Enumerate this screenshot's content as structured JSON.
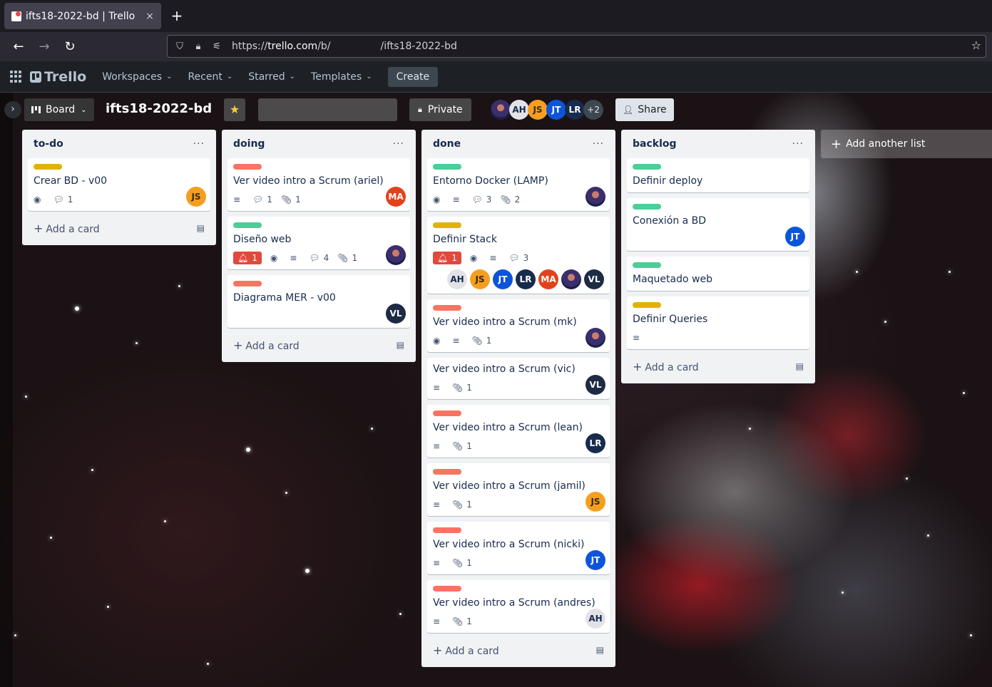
{
  "browser": {
    "tab_title": "ifts18-2022-bd | Trello",
    "tab_close": "×",
    "new_tab": "+",
    "url_prefix": "https://",
    "url_host": "trello.com",
    "url_path": "/b/",
    "url_board": "/ifts18-2022-bd"
  },
  "header": {
    "logo": "Trello",
    "menus": [
      {
        "label": "Workspaces"
      },
      {
        "label": "Recent"
      },
      {
        "label": "Starred"
      },
      {
        "label": "Templates"
      }
    ],
    "create": "Create"
  },
  "boardbar": {
    "view": "Board",
    "title": "ifts18-2022-bd",
    "visibility": "Private",
    "members": [
      {
        "type": "photo",
        "initials": ""
      },
      {
        "type": "ah",
        "initials": "AH"
      },
      {
        "type": "js",
        "initials": "JS"
      },
      {
        "type": "jt",
        "initials": "JT"
      },
      {
        "type": "lr",
        "initials": "LR"
      }
    ],
    "more_members": "+2",
    "share": "Share"
  },
  "colors": {
    "green": "#4bce97",
    "yellow": "#e2b203",
    "red": "#f87462"
  },
  "lists": [
    {
      "title": "to-do",
      "add_card": "Add a card",
      "cards": [
        {
          "label": "yellow",
          "title": "Crear BD - v00",
          "badges": [
            {
              "icon": "eye-icon"
            },
            {
              "icon": "comment-icon",
              "count": "1"
            }
          ],
          "members": [
            "js"
          ]
        }
      ]
    },
    {
      "title": "doing",
      "add_card": "Add a card",
      "cards": [
        {
          "label": "red",
          "title": "Ver video intro a Scrum (ariel)",
          "badges": [
            {
              "icon": "description-icon"
            },
            {
              "icon": "comment-icon",
              "count": "1"
            },
            {
              "icon": "attachment-icon",
              "count": "1"
            }
          ],
          "members": [
            "ma"
          ]
        },
        {
          "label": "green",
          "title": "Diseño web",
          "badges": [
            {
              "icon": "bell-icon",
              "count": "1",
              "alert": true
            },
            {
              "icon": "eye-icon"
            },
            {
              "icon": "description-icon"
            },
            {
              "icon": "comment-icon",
              "count": "4"
            },
            {
              "icon": "attachment-icon",
              "count": "1"
            }
          ],
          "members": [
            "photo"
          ]
        },
        {
          "label": "red",
          "title": "Diagrama MER - v00",
          "badges": [],
          "members": [
            "vl"
          ]
        }
      ]
    },
    {
      "title": "done",
      "add_card": "Add a card",
      "cards": [
        {
          "label": "green",
          "title": "Entorno Docker (LAMP)",
          "badges": [
            {
              "icon": "eye-icon"
            },
            {
              "icon": "description-icon"
            },
            {
              "icon": "comment-icon",
              "count": "3"
            },
            {
              "icon": "attachment-icon",
              "count": "2"
            }
          ],
          "members": [
            "photo"
          ]
        },
        {
          "label": "yellow",
          "title": "Definir Stack",
          "multi": true,
          "badges": [
            {
              "icon": "bell-icon",
              "count": "1",
              "alert": true
            },
            {
              "icon": "eye-icon"
            },
            {
              "icon": "description-icon"
            },
            {
              "icon": "comment-icon",
              "count": "3"
            }
          ],
          "members": [
            "ah",
            "js",
            "jt",
            "lr",
            "ma",
            "photo",
            "vl"
          ]
        },
        {
          "label": "red",
          "title": "Ver video intro a Scrum (mk)",
          "badges": [
            {
              "icon": "eye-icon"
            },
            {
              "icon": "description-icon"
            },
            {
              "icon": "attachment-icon",
              "count": "1"
            }
          ],
          "members": [
            "photo"
          ]
        },
        {
          "label": "",
          "title": "Ver video intro a Scrum (vic)",
          "badges": [
            {
              "icon": "description-icon"
            },
            {
              "icon": "attachment-icon",
              "count": "1"
            }
          ],
          "members": [
            "vl"
          ]
        },
        {
          "label": "red",
          "title": "Ver video intro a Scrum (lean)",
          "badges": [
            {
              "icon": "description-icon"
            },
            {
              "icon": "attachment-icon",
              "count": "1"
            }
          ],
          "members": [
            "lr"
          ]
        },
        {
          "label": "red",
          "title": "Ver video intro a Scrum (jamil)",
          "badges": [
            {
              "icon": "description-icon"
            },
            {
              "icon": "attachment-icon",
              "count": "1"
            }
          ],
          "members": [
            "js"
          ]
        },
        {
          "label": "red",
          "title": "Ver video intro a Scrum (nicki)",
          "badges": [
            {
              "icon": "description-icon"
            },
            {
              "icon": "attachment-icon",
              "count": "1"
            }
          ],
          "members": [
            "jt"
          ]
        },
        {
          "label": "red",
          "title": "Ver video intro a Scrum (andres)",
          "badges": [
            {
              "icon": "description-icon"
            },
            {
              "icon": "attachment-icon",
              "count": "1"
            }
          ],
          "members": [
            "ah"
          ]
        }
      ]
    },
    {
      "title": "backlog",
      "add_card": "Add a card",
      "cards": [
        {
          "label": "green",
          "title": "Definir deploy",
          "badges": [],
          "members": []
        },
        {
          "label": "green",
          "title": "Conexión a BD",
          "badges": [],
          "members": [
            "jt"
          ]
        },
        {
          "label": "green",
          "title": "Maquetado web",
          "badges": [],
          "members": []
        },
        {
          "label": "yellow",
          "title": "Definir Queries",
          "badges": [
            {
              "icon": "description-icon"
            }
          ],
          "members": []
        }
      ]
    }
  ],
  "member_initials": {
    "js": "JS",
    "ma": "MA",
    "jt": "JT",
    "lr": "LR",
    "vl": "VL",
    "ah": "AH",
    "photo": ""
  },
  "add_list": "Add another list"
}
